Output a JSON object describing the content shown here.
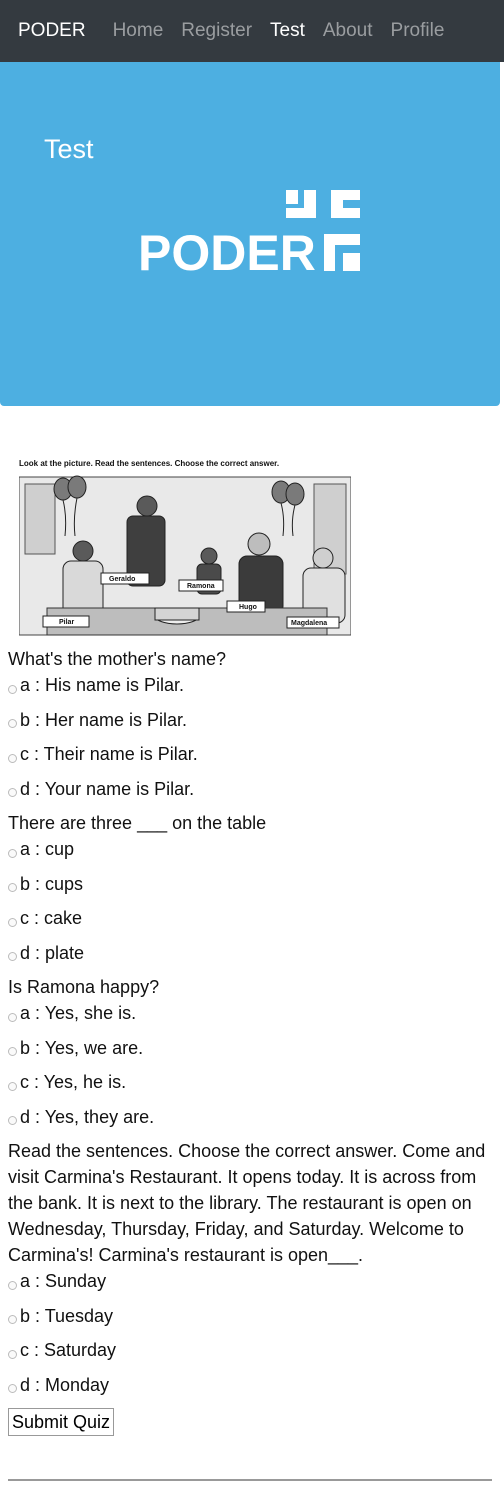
{
  "navbar": {
    "brand": "PODER",
    "links": [
      "Home",
      "Register",
      "Test",
      "About",
      "Profile"
    ],
    "active": "Test"
  },
  "hero": {
    "title": "Test",
    "logo_text": "PODER"
  },
  "image": {
    "instruction": "Look at the picture. Read the sentences. Choose the correct answer.",
    "labels": [
      "Geraldo",
      "Ramona",
      "Hugo",
      "Pilar",
      "Magdalena"
    ]
  },
  "questions": [
    {
      "text": "What's the mother's name?",
      "options": [
        "a : His name is Pilar.",
        "b : Her name is Pilar.",
        "c : Their name is Pilar.",
        "d : Your name is Pilar."
      ]
    },
    {
      "text": "There are three ___ on the table",
      "options": [
        "a : cup",
        "b : cups",
        "c : cake",
        "d : plate"
      ]
    },
    {
      "text": "Is Ramona happy?",
      "options": [
        "a : Yes, she is.",
        "b : Yes, we are.",
        "c : Yes, he is.",
        "d : Yes, they are."
      ]
    },
    {
      "text": "Read the sentences. Choose the correct answer. Come and visit Carmina's Restaurant. It opens today. It is across from the bank. It is next to the library. The restaurant is open on Wednesday, Thursday, Friday, and Saturday. Welcome to Carmina's! Carmina's restaurant is open___.",
      "options": [
        "a : Sunday",
        "b : Tuesday",
        "c : Saturday",
        "d : Monday"
      ]
    }
  ],
  "submit_label": "Submit Quiz",
  "colors": {
    "navbar_bg": "#343a40",
    "hero_bg": "#4dafe1"
  }
}
